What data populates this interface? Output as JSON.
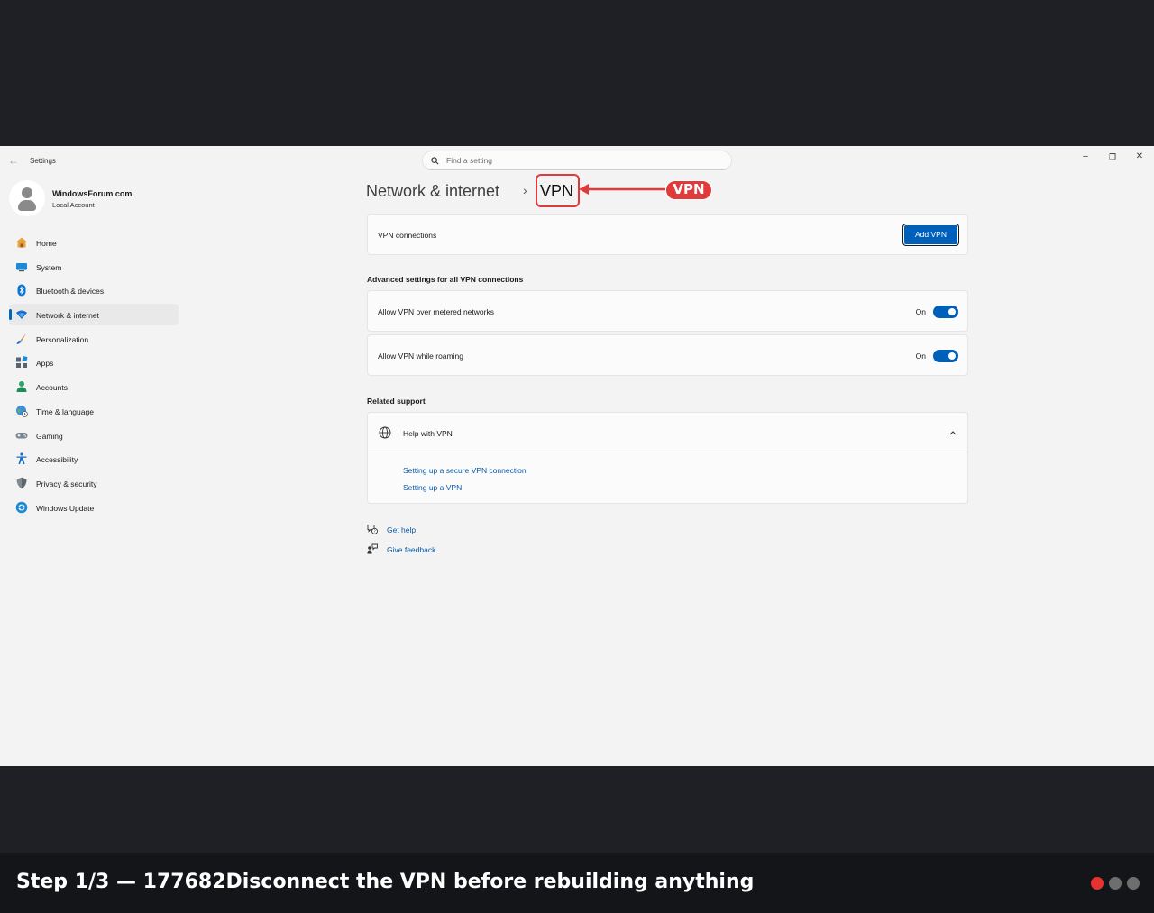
{
  "window": {
    "app_title": "Settings",
    "search_placeholder": "Find a setting",
    "controls": {
      "minimize": "–",
      "restore": "❐",
      "close": "✕"
    }
  },
  "profile": {
    "name": "WindowsForum.com",
    "account_type": "Local Account"
  },
  "sidebar": {
    "items": [
      {
        "label": "Home",
        "icon": "home-icon"
      },
      {
        "label": "System",
        "icon": "system-icon"
      },
      {
        "label": "Bluetooth & devices",
        "icon": "bluetooth-icon"
      },
      {
        "label": "Network & internet",
        "icon": "wifi-icon",
        "active": true
      },
      {
        "label": "Personalization",
        "icon": "brush-icon"
      },
      {
        "label": "Apps",
        "icon": "apps-icon"
      },
      {
        "label": "Accounts",
        "icon": "accounts-icon"
      },
      {
        "label": "Time & language",
        "icon": "globe-clock-icon"
      },
      {
        "label": "Gaming",
        "icon": "gamepad-icon"
      },
      {
        "label": "Accessibility",
        "icon": "accessibility-icon"
      },
      {
        "label": "Privacy & security",
        "icon": "shield-icon"
      },
      {
        "label": "Windows Update",
        "icon": "update-icon"
      }
    ]
  },
  "breadcrumb": {
    "parent": "Network & internet",
    "separator": "›",
    "current": "VPN"
  },
  "annotation": {
    "callout": "VPN",
    "color": "#e03a3a"
  },
  "vpn_connections": {
    "label": "VPN connections",
    "button": "Add VPN"
  },
  "advanced": {
    "title": "Advanced settings for all VPN connections",
    "metered": {
      "label": "Allow VPN over metered networks",
      "state": "On",
      "enabled": true
    },
    "roaming": {
      "label": "Allow VPN while roaming",
      "state": "On",
      "enabled": true
    }
  },
  "related_support": {
    "title": "Related support",
    "help_title": "Help with VPN",
    "links": [
      "Setting up a secure VPN connection",
      "Setting up a VPN"
    ]
  },
  "footer_links": {
    "get_help": "Get help",
    "give_feedback": "Give feedback"
  },
  "caption": {
    "text": "Step 1/3 — 177682Disconnect the VPN before rebuilding anything",
    "dot_colors": [
      "#e8322f",
      "#6e6e6e",
      "#6e6e6e"
    ]
  },
  "colors": {
    "accent": "#005fb8",
    "link": "#0a5aa8"
  }
}
